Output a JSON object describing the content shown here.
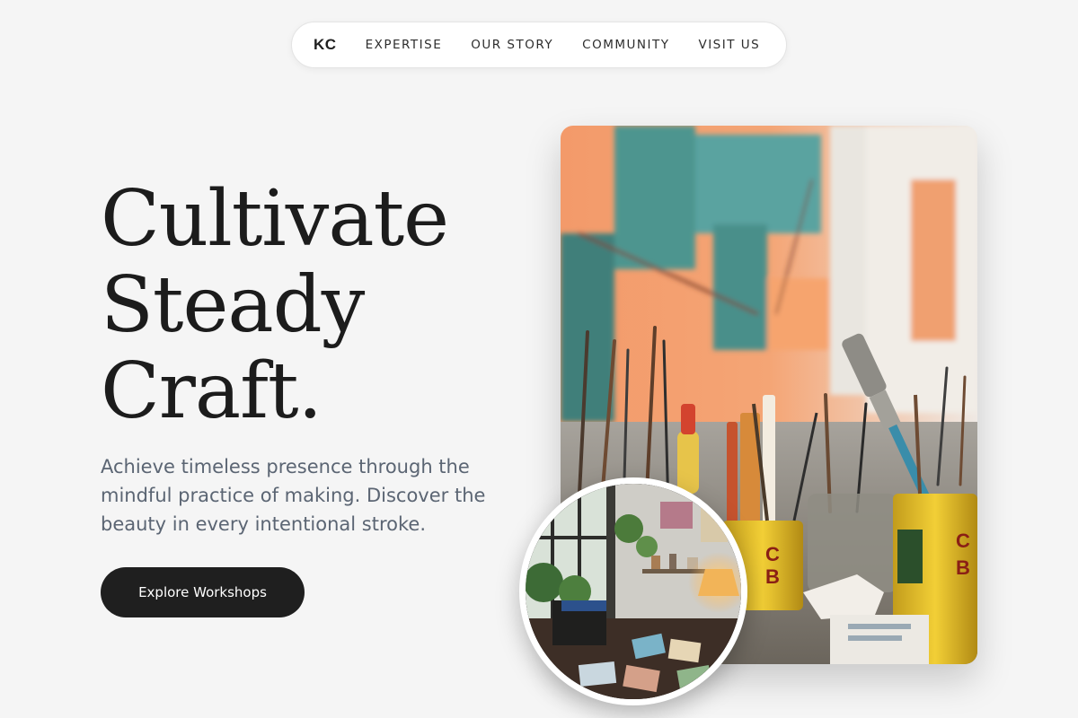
{
  "nav": {
    "logo": "KC",
    "links": [
      "EXPERTISE",
      "OUR STORY",
      "COMMUNITY",
      "VISIT US"
    ]
  },
  "hero": {
    "headline_lines": [
      "Cultivate",
      "Steady",
      "Craft."
    ],
    "subtext": "Achieve timeless presence through the mindful practice of making. Discover the beauty in every intentional stroke.",
    "cta_label": "Explore Workshops"
  },
  "images": {
    "main": "art-supplies-photo",
    "inset": "studio-interior-photo"
  },
  "colors": {
    "background": "#f5f5f5",
    "text_dark": "#1f1f1f",
    "text_muted": "#5b6573",
    "button_bg": "#1f1f1f",
    "button_text": "#ffffff"
  }
}
